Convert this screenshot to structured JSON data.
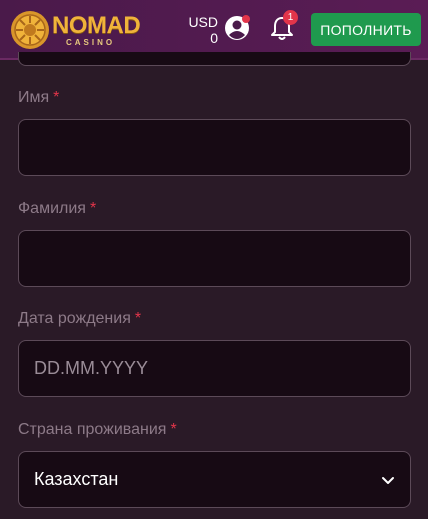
{
  "header": {
    "logo_main": "NOMAD",
    "logo_sub": "CASINO",
    "currency": "USD",
    "balance": "0",
    "notifications_count": "1",
    "deposit_label": "ПОПОЛНИТЬ"
  },
  "form": {
    "first_name": {
      "label": "Имя",
      "required_mark": "*",
      "value": ""
    },
    "last_name": {
      "label": "Фамилия",
      "required_mark": "*",
      "value": ""
    },
    "birth_date": {
      "label": "Дата рождения",
      "required_mark": "*",
      "placeholder": "DD.MM.YYYY",
      "value": ""
    },
    "country": {
      "label": "Страна проживания",
      "required_mark": "*",
      "selected": "Казахстан"
    }
  },
  "colors": {
    "accent_green": "#1f9a4e",
    "required_red": "#e2354a",
    "logo_gold": "#f0b33a",
    "header_purple": "#4a1a4a"
  },
  "icons": [
    "logo-emblem",
    "user-avatar-icon",
    "bell-icon",
    "chevron-down-icon"
  ]
}
